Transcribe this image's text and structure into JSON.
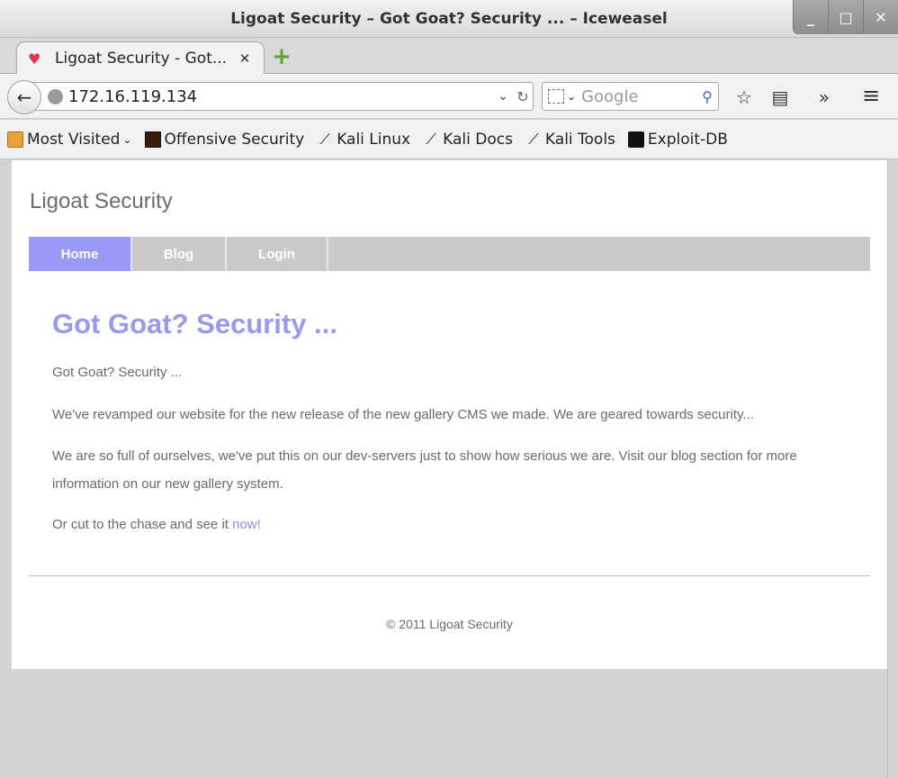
{
  "window": {
    "title": "Ligoat Security – Got Goat? Security ... – Iceweasel",
    "controls": {
      "minimize": "_",
      "maximize": "□",
      "close": "✕"
    }
  },
  "tabs": [
    {
      "title": "Ligoat Security - Got...",
      "favicon": "iceweasel-paw-icon",
      "close": "✕"
    }
  ],
  "newtab": {
    "label": "+"
  },
  "navbar": {
    "back": "←",
    "url": "172.16.119.134",
    "url_dropdown": "⌄",
    "reload": "↻",
    "search_placeholder": "Google",
    "search_engine_caret": "⌄",
    "search_icon": "⚲",
    "bookmark_star": "☆",
    "reader": "▤",
    "overflow": "»",
    "menu": "≡"
  },
  "bookmarks": [
    {
      "label": "Most Visited",
      "icon": "folder-icon",
      "caret": "⌄"
    },
    {
      "label": "Offensive Security",
      "icon": "offsec-icon"
    },
    {
      "label": "Kali Linux",
      "icon": "kali-dragon-icon"
    },
    {
      "label": "Kali Docs",
      "icon": "kali-dragon-icon"
    },
    {
      "label": "Kali Tools",
      "icon": "kali-dragon-icon"
    },
    {
      "label": "Exploit-DB",
      "icon": "exploitdb-icon"
    }
  ],
  "page": {
    "site_title": "Ligoat Security",
    "menu": [
      {
        "label": "Home",
        "active": true
      },
      {
        "label": "Blog",
        "active": false
      },
      {
        "label": "Login",
        "active": false
      }
    ],
    "post_title": "Got Goat? Security ...",
    "paragraphs": [
      "Got Goat? Security ...",
      "We've revamped our website for the new release of the new gallery CMS we made. We are geared towards security...",
      "We are so full of ourselves, we've put this on our dev-servers just to show how serious we are. Visit our blog section for more information on our new gallery system."
    ],
    "cta_text": "Or cut to the chase and see it ",
    "cta_link": "now!",
    "footer": "© 2011 Ligoat Security"
  },
  "colors": {
    "accent": "#9999f7",
    "menu_bg": "#cacaca",
    "link": "#8f8fee",
    "text": "#6a6a6a"
  }
}
